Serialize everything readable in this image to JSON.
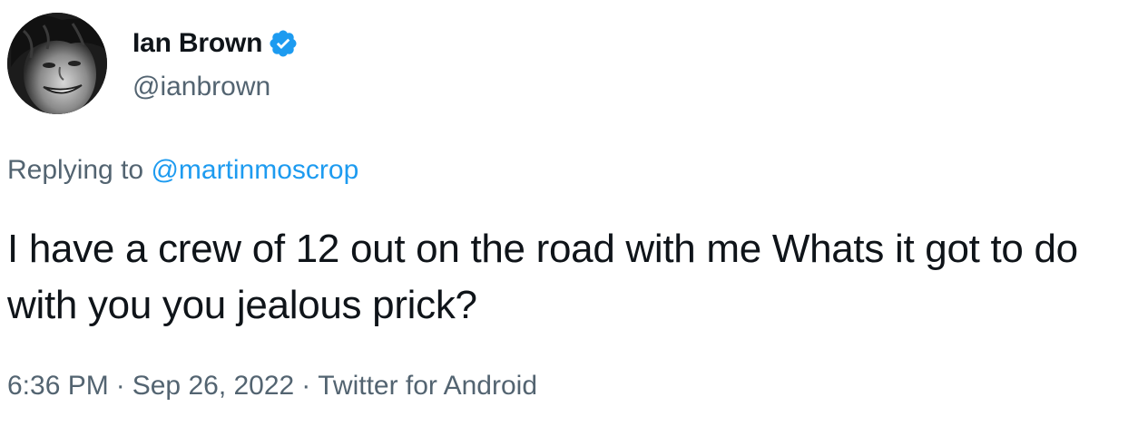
{
  "author": {
    "display_name": "Ian Brown",
    "handle": "@ianbrown",
    "verified": true,
    "verified_color": "#1d9bf0"
  },
  "reply": {
    "prefix": "Replying to ",
    "mention": "@martinmoscrop"
  },
  "tweet": {
    "text": "I have a crew of 12 out on the road with me Whats it got to do with you you jealous prick?"
  },
  "meta": {
    "time": "6:36 PM",
    "separator": "·",
    "date": "Sep 26, 2022",
    "source": "Twitter for Android"
  },
  "icons": {
    "avatar": "profile-photo",
    "verified": "verified-badge-icon"
  },
  "colors": {
    "text": "#0f1419",
    "secondary": "#536471",
    "link": "#1d9bf0"
  }
}
